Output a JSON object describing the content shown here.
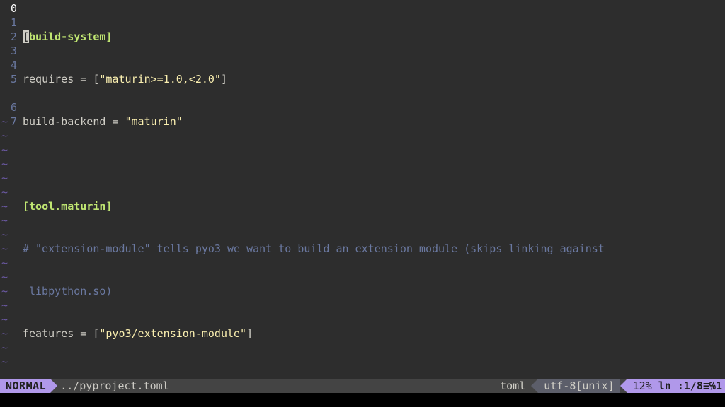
{
  "lines": [
    {
      "n": "0",
      "is_current": true
    },
    {
      "n": "1"
    },
    {
      "n": "2"
    },
    {
      "n": "3"
    },
    {
      "n": "4"
    },
    {
      "n": "5"
    },
    {
      "n": ""
    },
    {
      "n": "6"
    },
    {
      "n": "7"
    }
  ],
  "code": {
    "l0_open": "[",
    "l0_section": "build-system]",
    "l1_key": "requires = [",
    "l1_str": "\"maturin>=1.0,<2.0\"",
    "l1_close": "]",
    "l2_key": "build-backend = ",
    "l2_str": "\"maturin\"",
    "l4_section": "[tool.maturin]",
    "l5_comment": "# \"extension-module\" tells pyo3 we want to build an extension module (skips linking against",
    "l5_comment2": "libpython.so)",
    "l6_key": "features = [",
    "l6_str": "\"pyo3/extension-module\"",
    "l6_close": "]"
  },
  "tilde": "~",
  "status": {
    "mode": "NORMAL",
    "filepath": "../pyproject.toml",
    "filetype": "toml",
    "encoding": "utf-8[unix]",
    "percent": "12%",
    "position": "ln :1/8≡℅1"
  }
}
